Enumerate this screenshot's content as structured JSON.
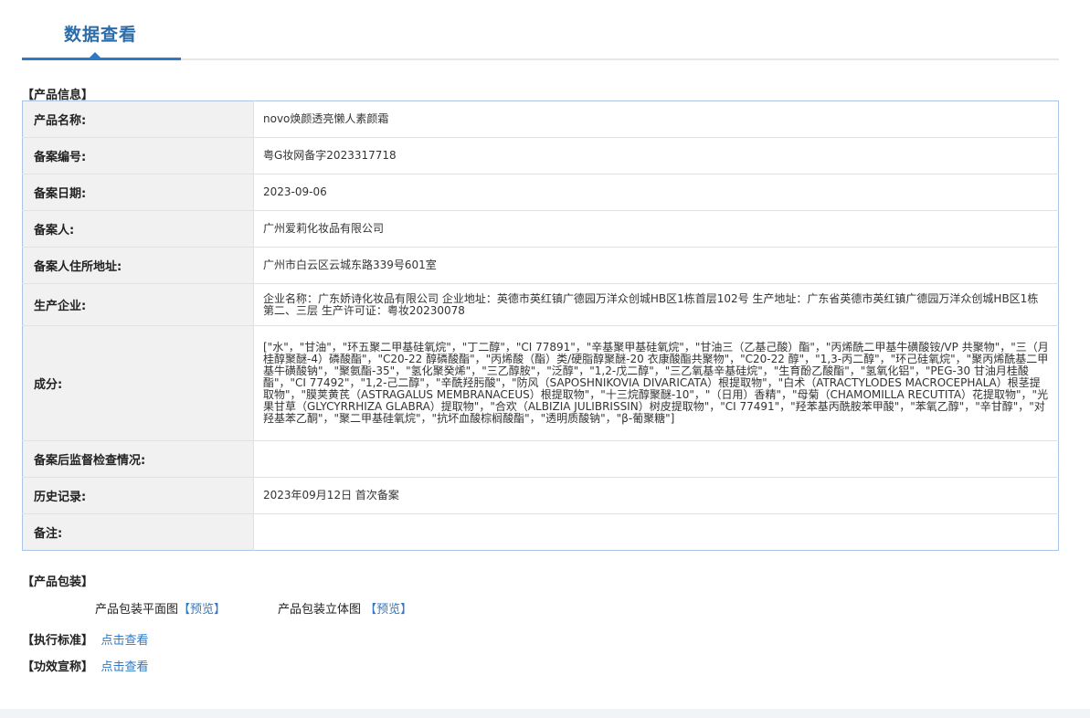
{
  "page_title": "数据查看",
  "sections": {
    "product_info": "【产品信息】",
    "product_package": "【产品包装】",
    "standard": "【执行标准】",
    "efficacy": "【功效宣称】"
  },
  "rows": [
    {
      "label": "产品名称:",
      "value": "novo焕颜透亮懒人素颜霜"
    },
    {
      "label": "备案编号:",
      "value": "粤G妆网备字2023317718"
    },
    {
      "label": "备案日期:",
      "value": "2023-09-06"
    },
    {
      "label": "备案人:",
      "value": "广州爱莉化妆品有限公司"
    },
    {
      "label": "备案人住所地址:",
      "value": "广州市白云区云城东路339号601室"
    },
    {
      "label": "生产企业:",
      "value": "企业名称：广东娇诗化妆品有限公司 企业地址：英德市英红镇广德园万洋众创城HB区1栋首层102号 生产地址：广东省英德市英红镇广德园万洋众创城HB区1栋第二、三层 生产许可证：粤妆20230078"
    },
    {
      "label": "成分:",
      "value": "[\"水\"，\"甘油\"，\"环五聚二甲基硅氧烷\"，\"丁二醇\"，\"CI 77891\"，\"辛基聚甲基硅氧烷\"，\"甘油三（乙基己酸）酯\"，\"丙烯酰二甲基牛磺酸铵/VP 共聚物\"，\"三（月桂醇聚醚-4）磷酸酯\"，\"C20-22 醇磷酸酯\"，\"丙烯酸（酯）类/硬脂醇聚醚-20 衣康酸酯共聚物\"，\"C20-22 醇\"，\"1,3-丙二醇\"，\"环己硅氧烷\"，\"聚丙烯酰基二甲基牛磺酸钠\"，\"聚氨酯-35\"，\"氢化聚癸烯\"，\"三乙醇胺\"，\"泛醇\"，\"1,2-戊二醇\"，\"三乙氧基辛基硅烷\"，\"生育酚乙酸酯\"，\"氢氧化铝\"，\"PEG-30 甘油月桂酸酯\"，\"CI 77492\"，\"1,2-己二醇\"，\"辛酰羟肟酸\"，\"防风（SAPOSHNIKOVIA DIVARICATA）根提取物\"，\"白术（ATRACTYLODES MACROCEPHALA）根茎提取物\"，\"膜荚黄芪（ASTRAGALUS MEMBRANACEUS）根提取物\"，\"十三烷醇聚醚-10\"，\"（日用）香精\"，\"母菊（CHAMOMILLA RECUTITA）花提取物\"，\"光果甘草（GLYCYRRHIZA GLABRA）提取物\"，\"合欢（ALBIZIA JULIBRISSIN）树皮提取物\"，\"CI 77491\"，\"羟苯基丙酰胺苯甲酸\"，\"苯氧乙醇\"，\"辛甘醇\"，\"对羟基苯乙酮\"，\"聚二甲基硅氧烷\"，\"抗坏血酸棕榈酸酯\"，\"透明质酸钠\"，\"β-葡聚糖\"]"
    },
    {
      "label": "备案后监督检查情况:",
      "value": ""
    },
    {
      "label": "历史记录:",
      "value": "2023年09月12日 首次备案"
    },
    {
      "label": "备注:",
      "value": ""
    }
  ],
  "package": {
    "flat_label": "产品包装平面图",
    "flat_preview": "【预览】",
    "stereo_label": "产品包装立体图",
    "stereo_preview": "【预览】"
  },
  "links": {
    "standard": "点击查看",
    "efficacy": "点击查看"
  }
}
